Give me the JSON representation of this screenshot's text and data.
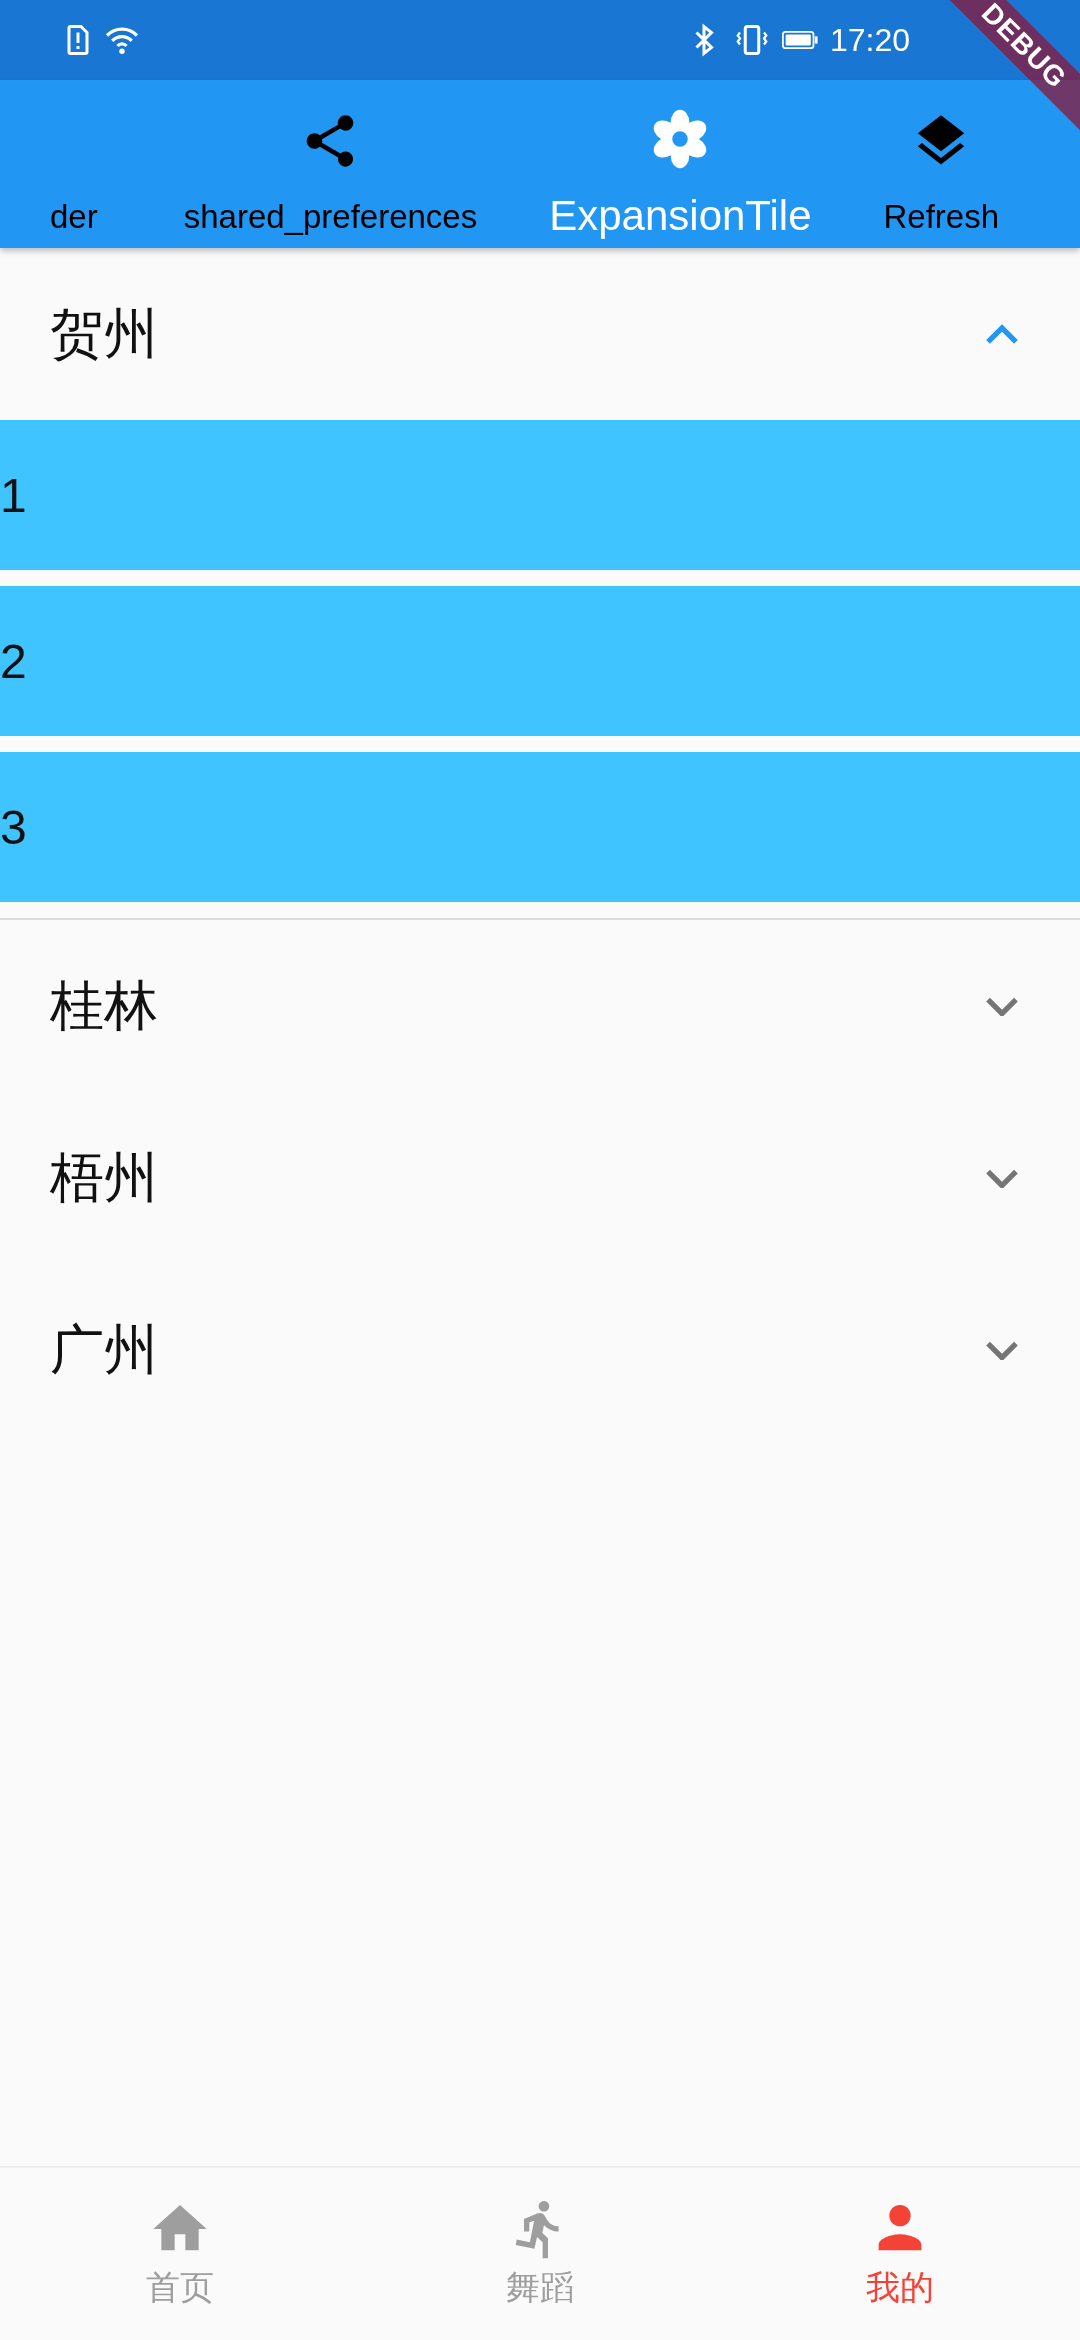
{
  "status_bar": {
    "time": "17:20"
  },
  "debug_banner": {
    "label": "DEBUG"
  },
  "tabs": [
    {
      "label": "der",
      "kind": "text",
      "selected": false
    },
    {
      "label": "shared_preferences",
      "kind": "share",
      "selected": false
    },
    {
      "label": "ExpansionTile",
      "kind": "flower",
      "selected": true
    },
    {
      "label": "Refresh",
      "kind": "layers",
      "selected": false
    }
  ],
  "tiles": [
    {
      "title": "贺州",
      "expanded": true,
      "children": [
        {
          "label": "1"
        },
        {
          "label": "2"
        },
        {
          "label": "3"
        }
      ]
    },
    {
      "title": "桂林",
      "expanded": false
    },
    {
      "title": "梧州",
      "expanded": false
    },
    {
      "title": "广州",
      "expanded": false
    }
  ],
  "bottom_nav": [
    {
      "label": "首页",
      "kind": "home",
      "selected": false
    },
    {
      "label": "舞蹈",
      "kind": "run",
      "selected": false
    },
    {
      "label": "我的",
      "kind": "person",
      "selected": true
    }
  ]
}
